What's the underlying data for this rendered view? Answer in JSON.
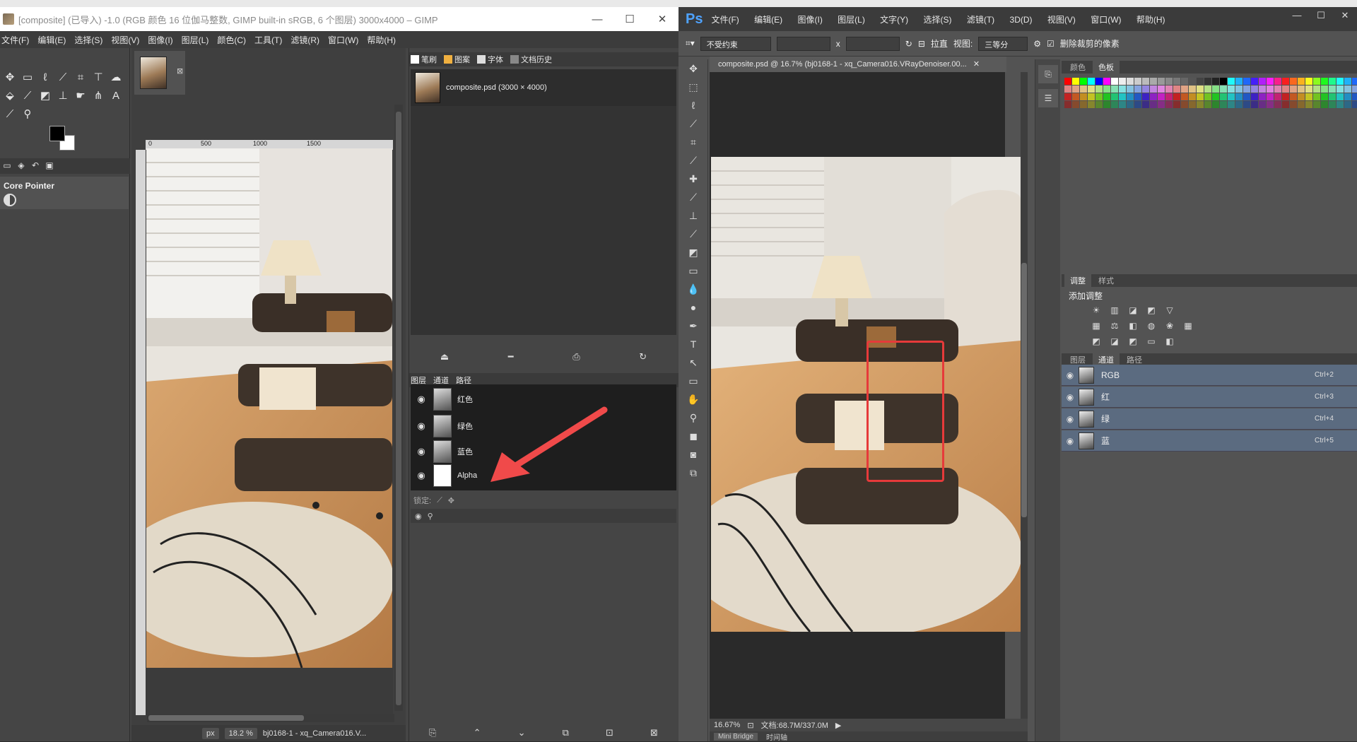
{
  "gimp": {
    "title": "[composite] (已导入) -1.0 (RGB 颜色 16 位伽马整数, GIMP built-in sRGB, 6 个图层) 3000x4000 – GIMP",
    "window_controls": [
      "—",
      "☐",
      "✕"
    ],
    "menu": [
      "文件(F)",
      "编辑(E)",
      "选择(S)",
      "视图(V)",
      "图像(I)",
      "图层(L)",
      "颜色(C)",
      "工具(T)",
      "滤镜(R)",
      "窗口(W)",
      "帮助(H)"
    ],
    "tool_options": {
      "title": "Core Pointer"
    },
    "ruler_ticks": [
      "0",
      "500",
      "1000",
      "1500"
    ],
    "status": {
      "unit": "px",
      "zoom": "18.2 %",
      "filename": "bj0168-1 - xq_Camera016.V..."
    },
    "dock_tabs_top": [
      "笔刷",
      "图案",
      "字体",
      "文档历史"
    ],
    "history_item": "composite.psd (3000 × 4000)",
    "dock_tabs_bottom": [
      "图层",
      "通道",
      "路径"
    ],
    "channels": [
      {
        "name": "红色"
      },
      {
        "name": "绿色"
      },
      {
        "name": "蓝色"
      },
      {
        "name": "Alpha"
      }
    ],
    "lock_label": "锁定:"
  },
  "photoshop": {
    "logo": "Ps",
    "window_controls": [
      "—",
      "☐",
      "✕"
    ],
    "menu": [
      "文件(F)",
      "编辑(E)",
      "图像(I)",
      "图层(L)",
      "文字(Y)",
      "选择(S)",
      "滤镜(T)",
      "3D(D)",
      "视图(V)",
      "窗口(W)",
      "帮助(H)"
    ],
    "options": {
      "ratio": "不受约束",
      "times": "x",
      "straighten": "拉直",
      "view_label": "视图:",
      "view_value": "三等分",
      "delete_cropped": "删除裁剪的像素"
    },
    "doc_tab": "composite.psd @ 16.7% (bj0168-1 - xq_Camera016.VRayDenoiser.00...",
    "doc_close": "✕",
    "status_zoom": "16.67%",
    "status_doc": "文档:68.7M/337.0M",
    "mini_tabs": [
      "Mini Bridge",
      "时间轴"
    ],
    "swatch_tabs": [
      "颜色",
      "色板"
    ],
    "adj_tabs": [
      "调整",
      "样式"
    ],
    "adj_title": "添加调整",
    "channel_tabs": [
      "图层",
      "通道",
      "路径"
    ],
    "channels": [
      {
        "name": "RGB",
        "shortcut": "Ctrl+2"
      },
      {
        "name": "红",
        "shortcut": "Ctrl+3"
      },
      {
        "name": "绿",
        "shortcut": "Ctrl+4"
      },
      {
        "name": "蓝",
        "shortcut": "Ctrl+5"
      }
    ],
    "annotation_color": "#e63a3a"
  }
}
